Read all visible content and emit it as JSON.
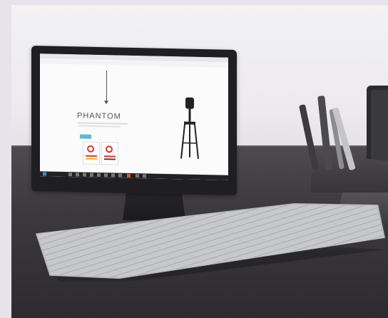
{
  "scene": {
    "screen": {
      "url": "",
      "hero_title": "PHANTOM"
    }
  },
  "colors": {
    "wall": "#eeecef",
    "desk": "#3d3a3e",
    "tablet_bezel": "#1f1e21",
    "badge_red": "#d8362b",
    "button_blue": "#5fb8d6",
    "keyboard": "#b7b8bb"
  }
}
